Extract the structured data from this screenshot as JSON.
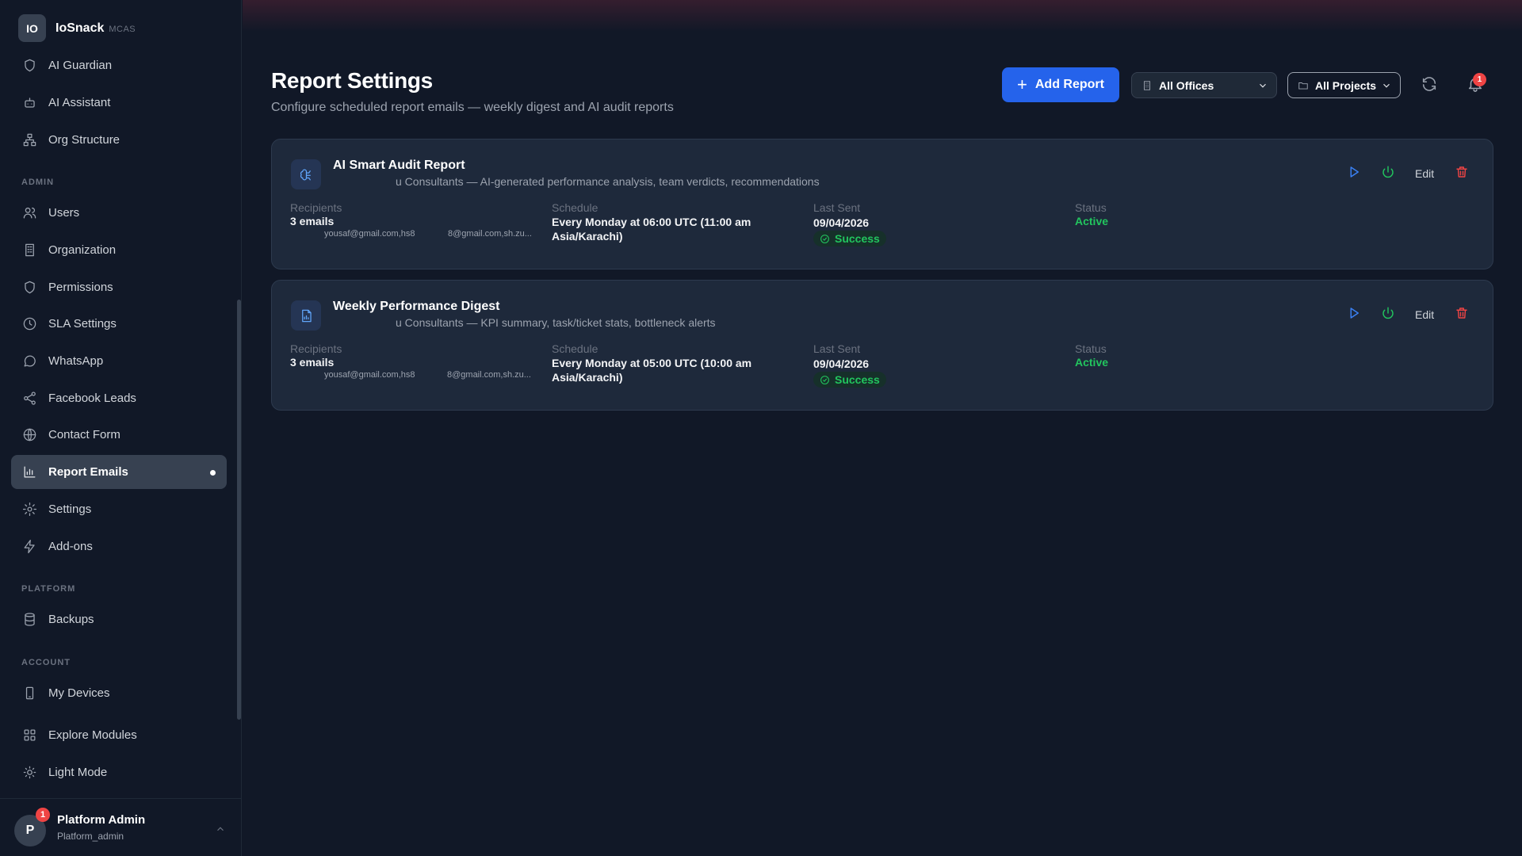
{
  "brand": {
    "logo": "IO",
    "name": "IoSnack",
    "tag": "MCAS"
  },
  "nav": {
    "top": [
      {
        "label": "AI Guardian",
        "icon": "shield-icon"
      },
      {
        "label": "AI Assistant",
        "icon": "bot-icon"
      },
      {
        "label": "Org Structure",
        "icon": "org-icon"
      }
    ],
    "admin_label": "ADMIN",
    "admin": [
      {
        "label": "Users",
        "icon": "users-icon"
      },
      {
        "label": "Organization",
        "icon": "building-icon"
      },
      {
        "label": "Permissions",
        "icon": "shield-icon"
      },
      {
        "label": "SLA Settings",
        "icon": "clock-icon"
      },
      {
        "label": "WhatsApp",
        "icon": "chat-icon"
      },
      {
        "label": "Facebook Leads",
        "icon": "share-icon"
      },
      {
        "label": "Contact Form",
        "icon": "globe-icon"
      },
      {
        "label": "Report Emails",
        "icon": "bar-chart-icon",
        "active": true
      },
      {
        "label": "Settings",
        "icon": "gear-icon"
      },
      {
        "label": "Add-ons",
        "icon": "bolt-icon"
      }
    ],
    "platform_label": "PLATFORM",
    "platform": [
      {
        "label": "Backups",
        "icon": "database-icon"
      }
    ],
    "account_label": "ACCOUNT",
    "account": [
      {
        "label": "My Devices",
        "icon": "device-icon"
      },
      {
        "label": "Explore Modules",
        "icon": "grid-icon"
      },
      {
        "label": "Light Mode",
        "icon": "sun-icon"
      }
    ]
  },
  "user": {
    "initial": "P",
    "badge": "1",
    "name": "Platform Admin",
    "role": "Platform_admin"
  },
  "header": {
    "title": "Report Settings",
    "subtitle": "Configure scheduled report emails — weekly digest and AI audit reports",
    "add_button": "Add Report",
    "offices": "All Offices",
    "projects": "All Projects",
    "notification_count": "1"
  },
  "columns": {
    "recipients": "Recipients",
    "schedule": "Schedule",
    "last_sent": "Last Sent",
    "status": "Status"
  },
  "reports": [
    {
      "icon": "brain-icon",
      "title": "AI Smart Audit Report",
      "description": "u Consultants — AI-generated performance analysis, team verdicts, recommendations",
      "recipients": "3 emails",
      "email_a": "yousaf@gmail.com,hs8",
      "email_b": "8@gmail.com,sh.zu...",
      "schedule": "Every Monday at 06:00 UTC (11:00 am Asia/Karachi)",
      "last_sent": "09/04/2026",
      "last_result": "Success",
      "status": "Active",
      "edit": "Edit"
    },
    {
      "icon": "file-chart-icon",
      "title": "Weekly Performance Digest",
      "description": "u Consultants — KPI summary, task/ticket stats, bottleneck alerts",
      "recipients": "3 emails",
      "email_a": "yousaf@gmail.com,hs8",
      "email_b": "8@gmail.com,sh.zu...",
      "schedule": "Every Monday at 05:00 UTC (10:00 am Asia/Karachi)",
      "last_sent": "09/04/2026",
      "last_result": "Success",
      "status": "Active",
      "edit": "Edit"
    }
  ],
  "colors": {
    "accent": "#2563eb",
    "success": "#22c55e",
    "danger": "#ef4444"
  }
}
